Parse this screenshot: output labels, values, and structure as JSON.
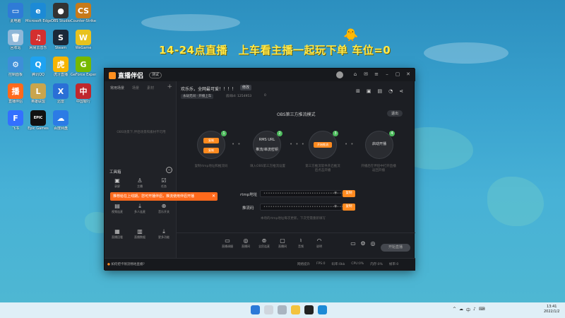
{
  "desktop": {
    "banner": "14-24点直播　上车看主播一起玩下单 车位=0",
    "icons": [
      {
        "label": "此电脑",
        "color": "#2f7bd6",
        "glyph": "▭"
      },
      {
        "label": "Microsoft Edge",
        "color": "#1c8ad6",
        "glyph": "e"
      },
      {
        "label": "OBS Studio",
        "color": "#333333",
        "glyph": "●"
      },
      {
        "label": "Counter-Strike",
        "color": "#c77a1a",
        "glyph": "CS"
      },
      {
        "label": "回收站",
        "color": "#8fb7d8",
        "glyph": "🗑"
      },
      {
        "label": "网易云音乐",
        "color": "#d42f2f",
        "glyph": "♫"
      },
      {
        "label": "Steam",
        "color": "#1b2838",
        "glyph": "S"
      },
      {
        "label": "WeGame",
        "color": "#e8c21e",
        "glyph": "W"
      },
      {
        "label": "控制面板",
        "color": "#3d8fd8",
        "glyph": "⚙"
      },
      {
        "label": "腾讯QQ",
        "color": "#1fa2f0",
        "glyph": "Q"
      },
      {
        "label": "虎牙直播",
        "color": "#f7b500",
        "glyph": "虎"
      },
      {
        "label": "GeForce Experience",
        "color": "#76b900",
        "glyph": "G"
      },
      {
        "label": "直播伴侣",
        "color": "#ff6a1c",
        "glyph": "播"
      },
      {
        "label": "英雄联盟",
        "color": "#c9a54d",
        "glyph": "L"
      },
      {
        "label": "迅雷",
        "color": "#2a6fd6",
        "glyph": "X"
      },
      {
        "label": "中国银行",
        "color": "#c0282d",
        "glyph": "中"
      },
      {
        "label": "飞书",
        "color": "#3370ff",
        "glyph": "F"
      },
      {
        "label": "Epic Games",
        "color": "#111111",
        "glyph": "EPIC"
      },
      {
        "label": "百度网盘",
        "color": "#2c7be5",
        "glyph": "☁"
      }
    ]
  },
  "app": {
    "version": "测试",
    "logo_text": "直播伴侣",
    "left_tabs": [
      "常用场景",
      "场景",
      "素材"
    ],
    "empty_hint": "OBS场景下,伴侣场景和素材不可用",
    "tools_title": "工具箱",
    "tools": [
      {
        "label": "录屏",
        "icon": "▣"
      },
      {
        "label": "主播",
        "icon": "♙"
      },
      {
        "label": "任务",
        "icon": "☑"
      },
      {
        "label": "视频连麦",
        "icon": "▤"
      },
      {
        "label": "多人连麦",
        "icon": "⤓"
      },
      {
        "label": "音乐开关",
        "icon": "⊕"
      },
      {
        "label": "直播回看",
        "icon": "▦"
      },
      {
        "label": "直播数据",
        "icon": "▥"
      },
      {
        "label": "更多功能",
        "icon": "⤓"
      }
    ],
    "tooltip": "推荐给在上线期，您可开播伴侣，推流使用伴侣开播",
    "room_title": "欢乐乐，全网最可爱！！！！",
    "edit_label": "修改",
    "category": "永劫无间 · 开播上车",
    "room_id_label": "房间id: 1254953",
    "room_count": "0",
    "mode_title": "OBS第三方推流模式",
    "exit_label": "退出",
    "steps": [
      {
        "num": "1",
        "text": "复制rtmp地址和推流码"
      },
      {
        "num": "2",
        "text": "填入OBS第三方推流设置"
      },
      {
        "num": "3",
        "text": "第三方推流软件开启推流\n后点击开播"
      },
      {
        "num": "4",
        "text": "开播后在伴侣中打开直播\n返回开播"
      }
    ],
    "step1_btn_a": "复制",
    "step1_btn_b": "复制",
    "step2_rtmp": "RMS URL",
    "step2_key": "推流/串流密钥",
    "step3_btn": "开始推流",
    "step4_btn": "启动开播",
    "rtmp_label": "rtmp地址",
    "rtmp_value": "•••••••••••••••••••••••••••••••••••",
    "key_label": "推流码",
    "key_value": "•••••••••••••••••••••••••••••••••••",
    "copy_label": "复制",
    "field_hint": "本场的rtmp地址每次更新，下次无需重新填写",
    "bottom_tools": [
      {
        "label": "直播调摄",
        "icon": "▭"
      },
      {
        "label": "直播间",
        "icon": "◎"
      },
      {
        "label": "全民连麦",
        "icon": "⊚"
      },
      {
        "label": "直播间",
        "icon": "▢"
      },
      {
        "label": "音频",
        "icon": "♮"
      },
      {
        "label": "说明",
        "icon": "◠"
      }
    ],
    "start_label": "开始直播",
    "status_text": "如何把卡顿流畅地直播?",
    "status_right": [
      "网络提升",
      "FPS:0",
      "码率:0kb",
      "CPU:0%",
      "内存:0%",
      "帧率:0"
    ]
  },
  "taskbar": {
    "time": "13:41",
    "date": "2022/1/2",
    "tray": [
      "^",
      "☁",
      "中",
      "♪",
      "⌨"
    ]
  }
}
